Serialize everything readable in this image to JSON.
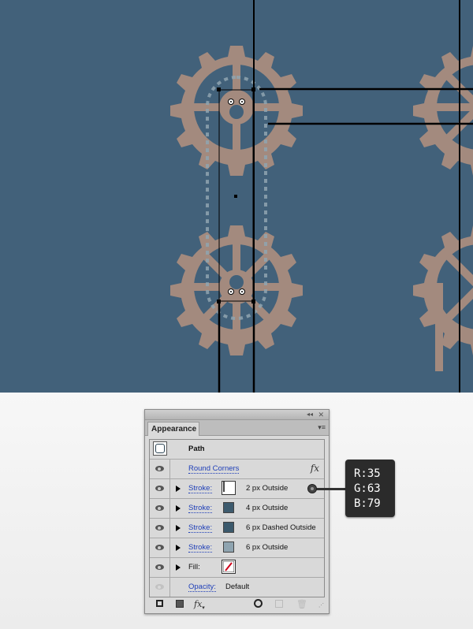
{
  "canvas": {
    "background_color": "#42617a",
    "gear_color": "#a38a7e",
    "gear_count_visible": 4
  },
  "panel": {
    "title_controls": {
      "collapse": "◂◂",
      "close": "✕"
    },
    "tab_label": "Appearance",
    "menu_icon": "▾≡",
    "object_label": "Path",
    "rows": [
      {
        "type": "effect",
        "label": "Round Corners",
        "fx_icon": "fx"
      },
      {
        "type": "stroke",
        "label": "Stroke:",
        "value": "2 px  Outside",
        "color": "#233f4f",
        "selected": true
      },
      {
        "type": "stroke",
        "label": "Stroke:",
        "value": "4 px  Outside",
        "color": "#3d5b6e"
      },
      {
        "type": "stroke",
        "label": "Stroke:",
        "value": "6 px Dashed Outside",
        "color": "#3b596c"
      },
      {
        "type": "stroke",
        "label": "Stroke:",
        "value": "6 px  Outside",
        "color": "#8fa4b0"
      },
      {
        "type": "fill",
        "label": "Fill:",
        "value": "none"
      },
      {
        "type": "opacity",
        "label": "Opacity:",
        "value": "Default"
      }
    ],
    "footer_icons": [
      "add-stroke-icon",
      "add-fill-icon",
      "fx-menu-icon",
      "clear-icon",
      "duplicate-icon",
      "delete-icon"
    ]
  },
  "tooltip": {
    "r_line": "R:35",
    "g_line": "G:63",
    "b_line": "B:79"
  }
}
